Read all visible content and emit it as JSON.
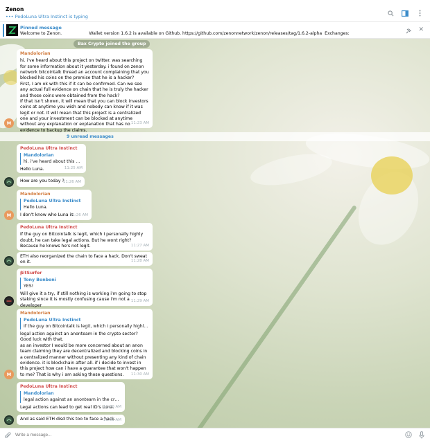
{
  "header": {
    "title": "Zenon",
    "typing": "••• PedoLuna Ultra Instinct is typing"
  },
  "pinned": {
    "title": "Pinned message",
    "text": "Welcome to Zenon.                    Wallet version 1.6.2 is available on Github. https://github.com/zenonnetwork/zenon/releases/tag/1.6.2-alpha  Exchanges:"
  },
  "service_message": "Bax Crypto joined the group",
  "unread_label": "9 unread messages",
  "composer": {
    "placeholder": "Write a message..."
  },
  "colors": {
    "accent": "#3a8bc9",
    "name_orange": "#d27d40",
    "name_red": "#d04a48"
  },
  "messages": [
    {
      "sender": "Mandolorian",
      "text": "hi. i've heard about this project on twitter. was searching for some information about it yesterday. i found on zenon network bitcointalk thread an account complaining that you blocked his coins on the premise that he is a hacker?\nFirst, I am ok with this if it can be confirmed. Can we see any actual full evidence on chain that he is truly the hacker and those coins were obtained from the hack?\nIf that isn't shown, it will mean that you can block investors coins at anytime you wish and nobody can know if it was legit or not. It will mean that this project is a centralized one and your investment can be blocked at anytime without any explanation or explanation that has no evidence to backup the claims.",
      "time": "11:23 AM",
      "avatar": "M"
    },
    {
      "sender": "PedoLuna Ultra Instinct",
      "reply_name": "Mandolorian",
      "reply_text": "hi. i've heard about this proje...",
      "text": "Hello Luna.",
      "time": "11:25 AM"
    },
    {
      "text": "How are you today ?",
      "time": "11:26 AM"
    },
    {
      "sender": "Mandolorian",
      "reply_name": "PedoLuna Ultra Instinct",
      "reply_text": "Hello Luna.",
      "text": "I don't know who Luna is",
      "time": "11:26 AM",
      "avatar": "M"
    },
    {
      "sender": "PedoLuna Ultra Instinct",
      "text": "If the guy on Bitcointalk is legit, which I personally highly doubt, he can take legal actions. But he wont right? Because he knows he's not legit.",
      "time": "11:27 AM"
    },
    {
      "text": "ETH also reorganized the chain to face a hack. Don't sweat on it.",
      "time": "11:28 AM"
    },
    {
      "sender": "βitSurfer",
      "reply_name": "Tony Bonboni",
      "reply_text": "YES!",
      "text": "Will give it a try, if still nothing is working i'm going to stop staking since it is mostly confusing cause i'm not a developer",
      "time": "11:29 AM"
    },
    {
      "sender": "Mandolorian",
      "reply_name": "PedoLuna Ultra Instinct",
      "reply_text": "If the guy on Bitcointalk is legit, which I personally highly doubt, ...",
      "text": "legal action against an anonteam in the crypto sector? Good luck with that.\nas an investor I would be more concerned about an anon team claiming they are decentralized and blocking coins in a centralized manner without presenting any kind of chain evidence. it is blockchain after all. if i decide to invest in this project how can i have a guarantee that won't happen to me?  That is why i am asking those questions.",
      "time": "11:30 AM",
      "avatar": "M"
    },
    {
      "sender": "PedoLuna Ultra Instinct",
      "reply_name": "Mandolorian",
      "reply_text": "legal action against an anonteam in the crypto sec...",
      "text": "Legal actions can lead to get real ID's Luna.",
      "time": "11:30 AM"
    },
    {
      "text": "And as said ETH disd this too to face a hack.",
      "time": "11:31 AM"
    }
  ]
}
